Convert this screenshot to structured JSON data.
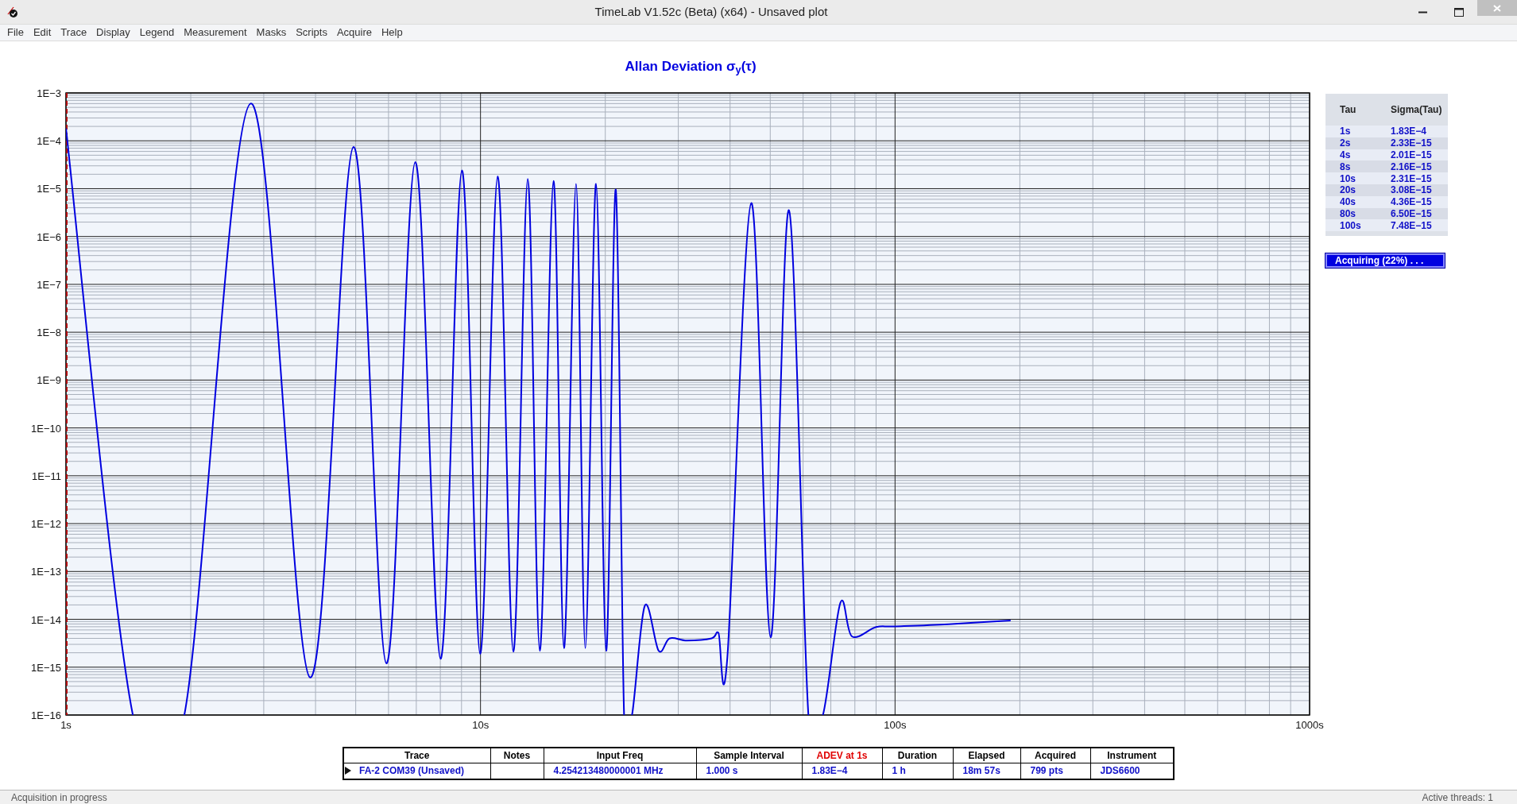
{
  "window": {
    "title": "TimeLab V1.52c (Beta) (x64) - Unsaved plot"
  },
  "menu": [
    "File",
    "Edit",
    "Trace",
    "Display",
    "Legend",
    "Measurement",
    "Masks",
    "Scripts",
    "Acquire",
    "Help"
  ],
  "chart": {
    "title": "Allan Deviation σ$_{y}$(τ)",
    "x_axis_labels": [
      "1s",
      "10s",
      "100s",
      "1000s"
    ],
    "y_axis_labels": [
      "1E−3",
      "1E−4",
      "1E−5",
      "1E−6",
      "1E−7",
      "1E−8",
      "1E−9",
      "1E−10",
      "1E−11",
      "1E−12",
      "1E−13",
      "1E−14",
      "1E−15",
      "1E−16"
    ]
  },
  "tau_table": {
    "columns": [
      "Tau",
      "Sigma(Tau)"
    ],
    "rows": [
      [
        "1s",
        "1.83E−4"
      ],
      [
        "2s",
        "2.33E−15"
      ],
      [
        "4s",
        "2.01E−15"
      ],
      [
        "8s",
        "2.16E−15"
      ],
      [
        "10s",
        "2.31E−15"
      ],
      [
        "20s",
        "3.08E−15"
      ],
      [
        "40s",
        "4.36E−15"
      ],
      [
        "80s",
        "6.50E−15"
      ],
      [
        "100s",
        "7.48E−15"
      ]
    ]
  },
  "progress": {
    "label": "Acquiring (22%) . . ."
  },
  "trace_table": {
    "columns": [
      {
        "label": "Trace",
        "highlighted": false
      },
      {
        "label": "Notes",
        "highlighted": false
      },
      {
        "label": "Input Freq",
        "highlighted": false
      },
      {
        "label": "Sample Interval",
        "highlighted": false
      },
      {
        "label": "ADEV at 1s",
        "highlighted": true
      },
      {
        "label": "Duration",
        "highlighted": false
      },
      {
        "label": "Elapsed",
        "highlighted": false
      },
      {
        "label": "Acquired",
        "highlighted": false
      },
      {
        "label": "Instrument",
        "highlighted": false
      }
    ],
    "rows": [
      {
        "cells": [
          "FA-2 COM39 (Unsaved)",
          "",
          "4.254213480000001 MHz",
          "1.000 s",
          "1.83E−4",
          "1 h",
          "18m 57s",
          "799 pts",
          "JDS6600"
        ]
      }
    ]
  },
  "status_bar": {
    "left": "Acquisition in progress",
    "right": "Active threads: 1"
  }
}
